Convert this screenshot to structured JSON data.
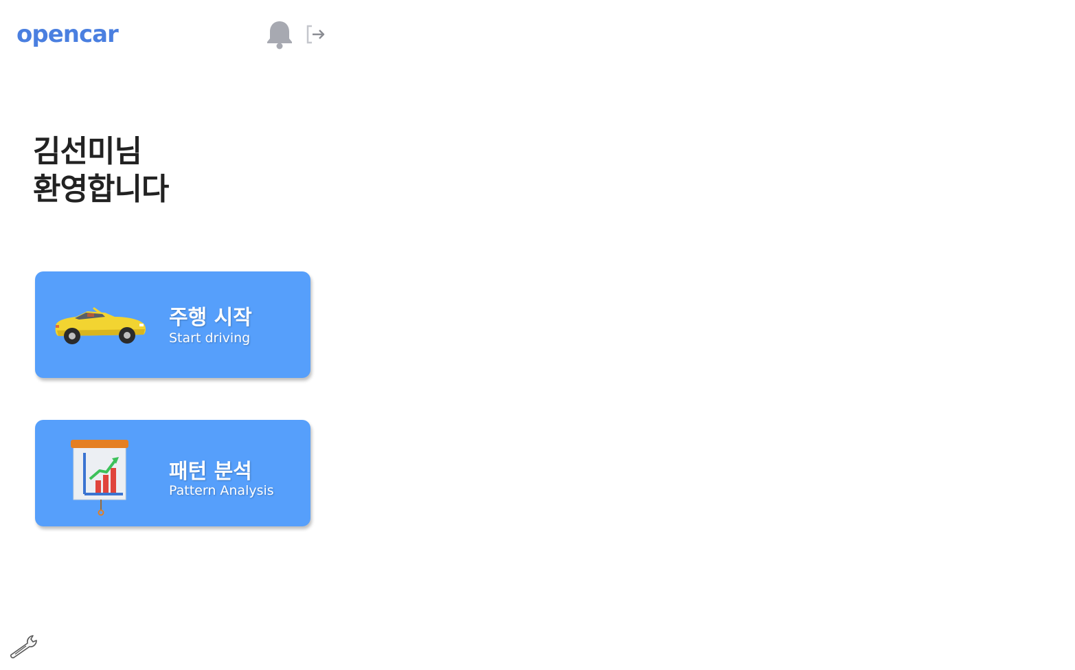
{
  "header": {
    "logo_text": "opencar",
    "icons": [
      "bell-icon",
      "logout-icon"
    ]
  },
  "welcome": {
    "line1": "김선미님",
    "line2": "환영합니다"
  },
  "cards": [
    {
      "title": "주행 시작",
      "subtitle": "Start driving",
      "icon": "car-icon"
    },
    {
      "title": "패턴 분석",
      "subtitle": "Pattern Analysis",
      "icon": "chart-board-icon"
    }
  ],
  "footer": {
    "icon": "wrench-icon"
  },
  "colors": {
    "brand": "#4a7fe0",
    "card_bg": "#569ffb",
    "icon_gray": "#a7a9b1",
    "text_dark": "#222222"
  }
}
